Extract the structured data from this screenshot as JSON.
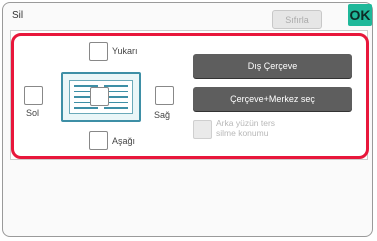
{
  "header": {
    "title": "Sil",
    "clear_label": "Sıfırla",
    "ok_label": "OK"
  },
  "positions": {
    "top": "Yukarı",
    "left": "Sol",
    "right": "Sağ",
    "bottom": "Aşağı"
  },
  "buttons": {
    "outer_frame": "Dış Çerçeve",
    "frame_center": "Çerçeve+Merkez seç"
  },
  "reverse_option": {
    "line1": "Arka yüzün ters",
    "line2": "silme konumu"
  },
  "colors": {
    "ok": "#1fb89a",
    "highlight": "#e8173b",
    "dark_button": "#5e5e5e"
  }
}
